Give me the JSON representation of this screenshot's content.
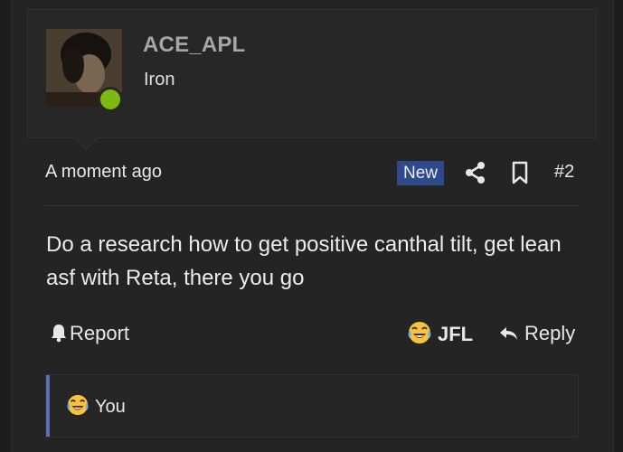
{
  "user": {
    "username": "ACE_APL",
    "title": "Iron",
    "online": true,
    "status_color": "#7cba10"
  },
  "post": {
    "timestamp": "A moment ago",
    "badge": "New",
    "number": "#2",
    "body": "Do a research how to get positive canthal tilt, get lean asf with Reta, there you go"
  },
  "actions": {
    "report_label": "Report",
    "reaction_label": "JFL",
    "reply_label": "Reply"
  },
  "reactions_summary": {
    "text": "You"
  },
  "colors": {
    "badge_bg": "#2e4a8a",
    "quote_accent": "#5b6fb6",
    "background": "#242424"
  },
  "icons": [
    "share-icon",
    "bookmark-icon",
    "bell-icon",
    "crying-laughing-emoji-icon",
    "reply-arrow-icon"
  ]
}
